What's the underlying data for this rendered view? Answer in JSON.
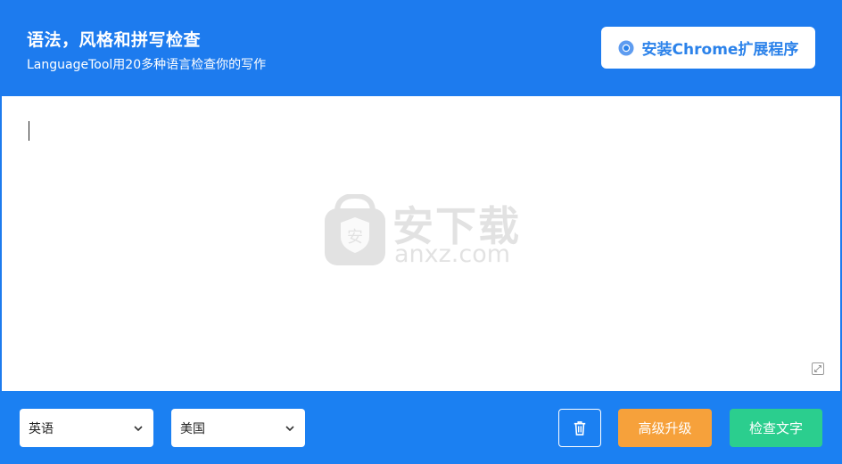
{
  "header": {
    "title": "语法，风格和拼写检查",
    "subtitle": "LanguageTool用20多种语言检查你的写作",
    "install_button_label": "安装Chrome扩展程序"
  },
  "editor": {
    "text": ""
  },
  "watermark": {
    "text_cn": "安下载",
    "text_en": "anxz.com",
    "shield_char": "安"
  },
  "footer": {
    "language_select": {
      "value": "英语"
    },
    "region_select": {
      "value": "美国"
    },
    "upgrade_label": "高级升级",
    "check_label": "检查文字"
  },
  "colors": {
    "header_bg": "#1d7bee",
    "footer_bg": "#1b80f2",
    "upgrade_bg": "#f6a13b",
    "check_bg": "#2bce8e",
    "install_text": "#2b82ea"
  },
  "icons": {
    "install": "chrome-icon",
    "trash": "trash-icon",
    "select_arrow": "chevron-down-icon",
    "resize": "resize-handle-icon"
  }
}
